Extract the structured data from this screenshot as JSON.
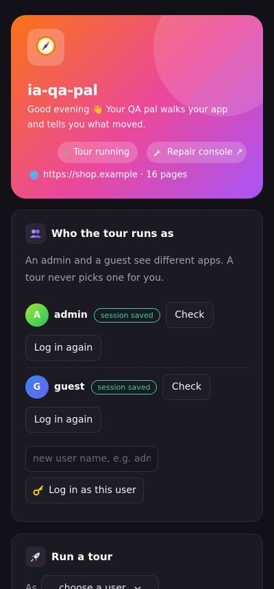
{
  "hero": {
    "app_name": "ia-qa-pal",
    "greeting": "Good evening 👋 Your QA pal walks your app and tells you what moved.",
    "tour_status": "Tour running",
    "repair_label": "Repair console ↗",
    "site": "https://shop.example · 16 pages",
    "icons": {
      "app": "compass-icon",
      "status": "green-dot",
      "repair": "wrench-icon",
      "site": "globe-icon"
    }
  },
  "who": {
    "title": "Who the tour runs as",
    "description": "An admin and a guest see different apps. A tour never picks one for you.",
    "users": [
      {
        "initial": "A",
        "name": "admin",
        "badge": "session saved",
        "check_label": "Check",
        "relogin_label": "Log in again"
      },
      {
        "initial": "G",
        "name": "guest",
        "badge": "session saved",
        "check_label": "Check",
        "relogin_label": "Log in again"
      }
    ],
    "new_user_placeholder": "new user name, e.g. admin",
    "new_user_value": "",
    "login_as_label": "Log in as this user"
  },
  "run": {
    "title": "Run a tour",
    "as_label": "As",
    "select_value": "choose a user"
  },
  "colors": {
    "accent_green": "#34d399",
    "hero_gradient": [
      "#f97316",
      "#ec4899",
      "#a855f7"
    ],
    "card_bg": "#1b1a22",
    "page_bg": "#121117"
  }
}
